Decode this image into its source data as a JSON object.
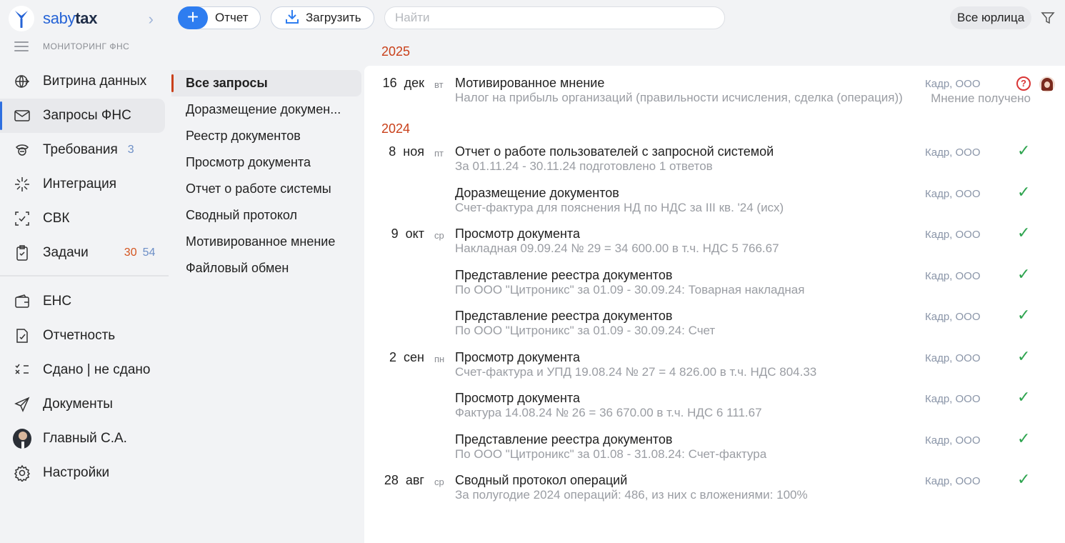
{
  "app": {
    "logo_main": "saby",
    "logo_bold": "tax",
    "section_label": "МОНИТОРИНГ ФНС"
  },
  "sidebar": {
    "items": [
      {
        "label": "Витрина данных",
        "icon": "globe-arrow-icon"
      },
      {
        "label": "Запросы ФНС",
        "icon": "envelope-icon",
        "active": true
      },
      {
        "label": "Требования",
        "icon": "officer-icon",
        "count": "3"
      },
      {
        "label": "Интеграция",
        "icon": "sparkle-icon"
      },
      {
        "label": "СВК",
        "icon": "check-frame-icon"
      },
      {
        "label": "Задачи",
        "icon": "clipboard-icon",
        "count_red": "30",
        "count": "54"
      },
      {
        "label": "ЕНС",
        "icon": "wallet-icon"
      },
      {
        "label": "Отчетность",
        "icon": "report-check-icon"
      },
      {
        "label": "Сдано | не сдано",
        "icon": "checklist-icon"
      },
      {
        "label": "Документы",
        "icon": "paper-plane-icon"
      },
      {
        "label": "Главный С.А.",
        "icon": "avatar"
      },
      {
        "label": "Настройки",
        "icon": "gear-icon"
      }
    ]
  },
  "toolbar": {
    "report_label": "Отчет",
    "upload_label": "Загрузить",
    "search_placeholder": "Найти",
    "legal_entities_label": "Все юрлица"
  },
  "categories": [
    {
      "label": "Все запросы",
      "active": true
    },
    {
      "label": "Доразмещение докумен..."
    },
    {
      "label": "Реестр документов"
    },
    {
      "label": "Просмотр документа"
    },
    {
      "label": "Отчет о работе системы"
    },
    {
      "label": "Сводный протокол"
    },
    {
      "label": "Мотивированное мнение"
    },
    {
      "label": "Файловый обмен"
    }
  ],
  "years": [
    "2025",
    "2024"
  ],
  "rows": [
    {
      "day": "16",
      "month": "дек",
      "dow": "вт",
      "title": "Мотивированное мнение",
      "subtitle": "Налог на прибыль организаций (правильности исчисления, сделка (операция))",
      "org": "Кадр, ООО",
      "status_text": "Мнение получено",
      "status": "question"
    },
    {
      "day": "8",
      "month": "ноя",
      "dow": "пт",
      "title": "Отчет о работе пользователей с запросной системой",
      "subtitle": "За 01.11.24 - 30.11.24 подготовлено 1 ответов",
      "org": "Кадр, ООО",
      "status": "done"
    },
    {
      "day": "",
      "month": "",
      "dow": "",
      "title": "Доразмещение документов",
      "subtitle": "Счет-фактура для пояснения НД по НДС за III кв. '24 (исх)",
      "org": "Кадр, ООО",
      "status": "done"
    },
    {
      "day": "9",
      "month": "окт",
      "dow": "ср",
      "title": "Просмотр документа",
      "subtitle": "Накладная 09.09.24 № 29 = 34 600.00 в т.ч. НДС 5 766.67",
      "org": "Кадр, ООО",
      "status": "done"
    },
    {
      "day": "",
      "month": "",
      "dow": "",
      "title": "Представление реестра документов",
      "subtitle": "По ООО \"Цитроникс\" за 01.09 - 30.09.24: Товарная накладная",
      "org": "Кадр, ООО",
      "status": "done"
    },
    {
      "day": "",
      "month": "",
      "dow": "",
      "title": "Представление реестра документов",
      "subtitle": "По ООО \"Цитроникс\" за 01.09 - 30.09.24: Счет",
      "org": "Кадр, ООО",
      "status": "done"
    },
    {
      "day": "2",
      "month": "сен",
      "dow": "пн",
      "title": "Просмотр документа",
      "subtitle": "Счет-фактура и УПД 19.08.24 № 27 = 4 826.00 в т.ч. НДС 804.33",
      "org": "Кадр, ООО",
      "status": "done"
    },
    {
      "day": "",
      "month": "",
      "dow": "",
      "title": "Просмотр документа",
      "subtitle": "Фактура 14.08.24 № 26 = 36 670.00 в т.ч. НДС 6 111.67",
      "org": "Кадр, ООО",
      "status": "done"
    },
    {
      "day": "",
      "month": "",
      "dow": "",
      "title": "Представление реестра документов",
      "subtitle": "По ООО \"Цитроникс\" за 01.08 - 31.08.24: Счет-фактура",
      "org": "Кадр, ООО",
      "status": "done"
    },
    {
      "day": "28",
      "month": "авг",
      "dow": "ср",
      "title": "Сводный протокол операций",
      "subtitle": "За полугодие 2024 операций: 486, из них с вложениями: 100%",
      "org": "Кадр, ООО",
      "status": "done"
    }
  ],
  "glyphs": {
    "check": "✓",
    "question": "?",
    "plus": "+",
    "chevron": "›"
  },
  "colors": {
    "accent": "#2e7df0",
    "year": "#c9401a",
    "check": "#2ea44f",
    "alert": "#d93535"
  }
}
